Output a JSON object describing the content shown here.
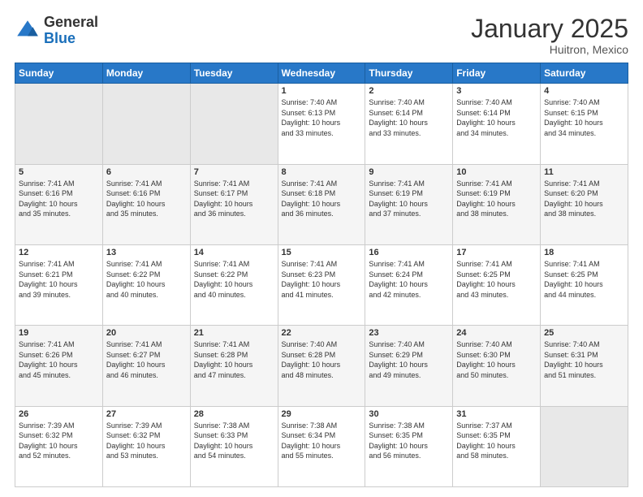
{
  "header": {
    "logo_general": "General",
    "logo_blue": "Blue",
    "month_title": "January 2025",
    "location": "Huitron, Mexico"
  },
  "days_of_week": [
    "Sunday",
    "Monday",
    "Tuesday",
    "Wednesday",
    "Thursday",
    "Friday",
    "Saturday"
  ],
  "weeks": [
    [
      {
        "num": "",
        "info": ""
      },
      {
        "num": "",
        "info": ""
      },
      {
        "num": "",
        "info": ""
      },
      {
        "num": "1",
        "info": "Sunrise: 7:40 AM\nSunset: 6:13 PM\nDaylight: 10 hours\nand 33 minutes."
      },
      {
        "num": "2",
        "info": "Sunrise: 7:40 AM\nSunset: 6:14 PM\nDaylight: 10 hours\nand 33 minutes."
      },
      {
        "num": "3",
        "info": "Sunrise: 7:40 AM\nSunset: 6:14 PM\nDaylight: 10 hours\nand 34 minutes."
      },
      {
        "num": "4",
        "info": "Sunrise: 7:40 AM\nSunset: 6:15 PM\nDaylight: 10 hours\nand 34 minutes."
      }
    ],
    [
      {
        "num": "5",
        "info": "Sunrise: 7:41 AM\nSunset: 6:16 PM\nDaylight: 10 hours\nand 35 minutes."
      },
      {
        "num": "6",
        "info": "Sunrise: 7:41 AM\nSunset: 6:16 PM\nDaylight: 10 hours\nand 35 minutes."
      },
      {
        "num": "7",
        "info": "Sunrise: 7:41 AM\nSunset: 6:17 PM\nDaylight: 10 hours\nand 36 minutes."
      },
      {
        "num": "8",
        "info": "Sunrise: 7:41 AM\nSunset: 6:18 PM\nDaylight: 10 hours\nand 36 minutes."
      },
      {
        "num": "9",
        "info": "Sunrise: 7:41 AM\nSunset: 6:19 PM\nDaylight: 10 hours\nand 37 minutes."
      },
      {
        "num": "10",
        "info": "Sunrise: 7:41 AM\nSunset: 6:19 PM\nDaylight: 10 hours\nand 38 minutes."
      },
      {
        "num": "11",
        "info": "Sunrise: 7:41 AM\nSunset: 6:20 PM\nDaylight: 10 hours\nand 38 minutes."
      }
    ],
    [
      {
        "num": "12",
        "info": "Sunrise: 7:41 AM\nSunset: 6:21 PM\nDaylight: 10 hours\nand 39 minutes."
      },
      {
        "num": "13",
        "info": "Sunrise: 7:41 AM\nSunset: 6:22 PM\nDaylight: 10 hours\nand 40 minutes."
      },
      {
        "num": "14",
        "info": "Sunrise: 7:41 AM\nSunset: 6:22 PM\nDaylight: 10 hours\nand 40 minutes."
      },
      {
        "num": "15",
        "info": "Sunrise: 7:41 AM\nSunset: 6:23 PM\nDaylight: 10 hours\nand 41 minutes."
      },
      {
        "num": "16",
        "info": "Sunrise: 7:41 AM\nSunset: 6:24 PM\nDaylight: 10 hours\nand 42 minutes."
      },
      {
        "num": "17",
        "info": "Sunrise: 7:41 AM\nSunset: 6:25 PM\nDaylight: 10 hours\nand 43 minutes."
      },
      {
        "num": "18",
        "info": "Sunrise: 7:41 AM\nSunset: 6:25 PM\nDaylight: 10 hours\nand 44 minutes."
      }
    ],
    [
      {
        "num": "19",
        "info": "Sunrise: 7:41 AM\nSunset: 6:26 PM\nDaylight: 10 hours\nand 45 minutes."
      },
      {
        "num": "20",
        "info": "Sunrise: 7:41 AM\nSunset: 6:27 PM\nDaylight: 10 hours\nand 46 minutes."
      },
      {
        "num": "21",
        "info": "Sunrise: 7:41 AM\nSunset: 6:28 PM\nDaylight: 10 hours\nand 47 minutes."
      },
      {
        "num": "22",
        "info": "Sunrise: 7:40 AM\nSunset: 6:28 PM\nDaylight: 10 hours\nand 48 minutes."
      },
      {
        "num": "23",
        "info": "Sunrise: 7:40 AM\nSunset: 6:29 PM\nDaylight: 10 hours\nand 49 minutes."
      },
      {
        "num": "24",
        "info": "Sunrise: 7:40 AM\nSunset: 6:30 PM\nDaylight: 10 hours\nand 50 minutes."
      },
      {
        "num": "25",
        "info": "Sunrise: 7:40 AM\nSunset: 6:31 PM\nDaylight: 10 hours\nand 51 minutes."
      }
    ],
    [
      {
        "num": "26",
        "info": "Sunrise: 7:39 AM\nSunset: 6:32 PM\nDaylight: 10 hours\nand 52 minutes."
      },
      {
        "num": "27",
        "info": "Sunrise: 7:39 AM\nSunset: 6:32 PM\nDaylight: 10 hours\nand 53 minutes."
      },
      {
        "num": "28",
        "info": "Sunrise: 7:38 AM\nSunset: 6:33 PM\nDaylight: 10 hours\nand 54 minutes."
      },
      {
        "num": "29",
        "info": "Sunrise: 7:38 AM\nSunset: 6:34 PM\nDaylight: 10 hours\nand 55 minutes."
      },
      {
        "num": "30",
        "info": "Sunrise: 7:38 AM\nSunset: 6:35 PM\nDaylight: 10 hours\nand 56 minutes."
      },
      {
        "num": "31",
        "info": "Sunrise: 7:37 AM\nSunset: 6:35 PM\nDaylight: 10 hours\nand 58 minutes."
      },
      {
        "num": "",
        "info": ""
      }
    ]
  ]
}
